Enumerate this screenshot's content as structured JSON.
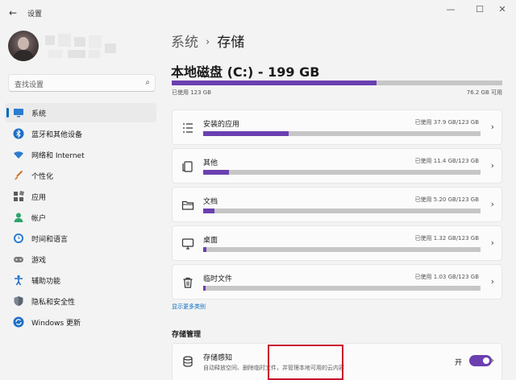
{
  "window": {
    "title": "设置",
    "back_icon": "back-arrow-icon",
    "controls": {
      "minimize": "—",
      "maximize": "☐",
      "close": "✕"
    }
  },
  "sidebar": {
    "search_placeholder": "查找设置",
    "items": [
      {
        "label": "系统",
        "icon": "system-icon",
        "active": true
      },
      {
        "label": "蓝牙和其他设备",
        "icon": "bluetooth-icon"
      },
      {
        "label": "网络和 Internet",
        "icon": "wifi-icon"
      },
      {
        "label": "个性化",
        "icon": "brush-icon"
      },
      {
        "label": "应用",
        "icon": "apps-icon"
      },
      {
        "label": "帐户",
        "icon": "account-icon"
      },
      {
        "label": "时间和语言",
        "icon": "time-language-icon"
      },
      {
        "label": "游戏",
        "icon": "gamepad-icon"
      },
      {
        "label": "辅助功能",
        "icon": "accessibility-icon"
      },
      {
        "label": "隐私和安全性",
        "icon": "shield-icon"
      },
      {
        "label": "Windows 更新",
        "icon": "update-icon"
      }
    ]
  },
  "main": {
    "breadcrumb": {
      "parent": "系统",
      "separator": "›",
      "current": "存储"
    },
    "disk": {
      "title": "本地磁盘 (C:) - 199 GB",
      "used_label": "已使用 123 GB",
      "free_label": "76.2 GB 可用",
      "used_fraction": 0.62
    },
    "categories": [
      {
        "name": "安装的应用",
        "usage": "已使用 37.9 GB/123 GB",
        "fraction": 0.308,
        "icon": "installed-apps-icon"
      },
      {
        "name": "其他",
        "usage": "已使用 11.4 GB/123 GB",
        "fraction": 0.093,
        "icon": "other-files-icon"
      },
      {
        "name": "文档",
        "usage": "已使用 5.20 GB/123 GB",
        "fraction": 0.042,
        "icon": "folder-icon"
      },
      {
        "name": "桌面",
        "usage": "已使用 1.32 GB/123 GB",
        "fraction": 0.011,
        "icon": "desktop-icon"
      },
      {
        "name": "临时文件",
        "usage": "已使用 1.03 GB/123 GB",
        "fraction": 0.008,
        "icon": "trash-icon"
      }
    ],
    "show_more": "显示更多类别",
    "management": {
      "section_title": "存储管理",
      "sense_name": "存储感知",
      "sense_desc": "自动释放空间、删除临时文件，并管理本地可用的云内容",
      "toggle_label": "开",
      "toggle_on": true
    }
  },
  "colors": {
    "accent": "#6b3fb0",
    "nav_indicator": "#0067c0",
    "highlight": "#c8102e"
  }
}
